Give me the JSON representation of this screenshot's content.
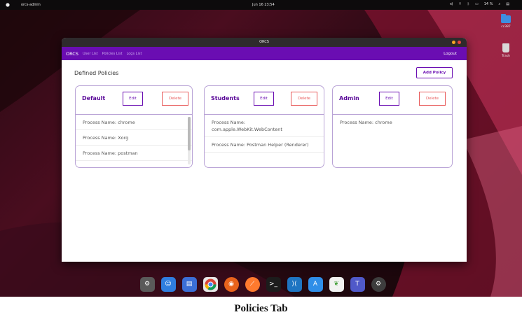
{
  "topbar": {
    "user": "orcs-admin",
    "clock": "Jun 16  23:54",
    "battery": "14 %"
  },
  "desktop_icons": [
    {
      "label": "cc387",
      "icon": "folder-icon"
    },
    {
      "label": "Trash",
      "icon": "trash-icon"
    }
  ],
  "window": {
    "title": "ORCS",
    "nav": {
      "brand": "ORCS",
      "links": [
        "User List",
        "Policies List",
        "Logs List"
      ],
      "logout": "Logout"
    },
    "page_title": "Defined Policies",
    "add_policy_label": "Add Policy",
    "edit_label": "Edit",
    "delete_label": "Delete",
    "policies": [
      {
        "name": "Default",
        "processes": [
          "Process Name: chrome",
          "Process Name: Xorg",
          "Process Name: postman"
        ]
      },
      {
        "name": "Students",
        "processes": [
          "Process Name: com.apple.WebKit.WebContent",
          "Process Name: Postman Helper (Renderer)"
        ]
      },
      {
        "name": "Admin",
        "processes": [
          "Process Name: chrome"
        ]
      }
    ]
  },
  "dock": [
    {
      "icon": "settings-icon",
      "color": "#5a5a5a"
    },
    {
      "icon": "finder-icon",
      "color": "#2f7ee0"
    },
    {
      "icon": "files-icon",
      "color": "#3b6fd6"
    },
    {
      "icon": "chrome-icon",
      "color": "#e8e8e8"
    },
    {
      "icon": "firefox-icon",
      "color": "#e8631c"
    },
    {
      "icon": "safari-icon",
      "color": "#ff7a2e"
    },
    {
      "icon": "terminal-icon",
      "color": "#1c1c1c"
    },
    {
      "icon": "vscode-icon",
      "color": "#1e75c2"
    },
    {
      "icon": "app-store-icon",
      "color": "#2f8ee8"
    },
    {
      "icon": "mongodb-icon",
      "color": "#f2f2f2"
    },
    {
      "icon": "teams-icon",
      "color": "#5059c9"
    },
    {
      "icon": "settings-gear-icon",
      "color": "#3d3d3d"
    }
  ],
  "caption": "Policies Tab",
  "colors": {
    "accent": "#6a0db2",
    "delete": "#e85a5a"
  }
}
